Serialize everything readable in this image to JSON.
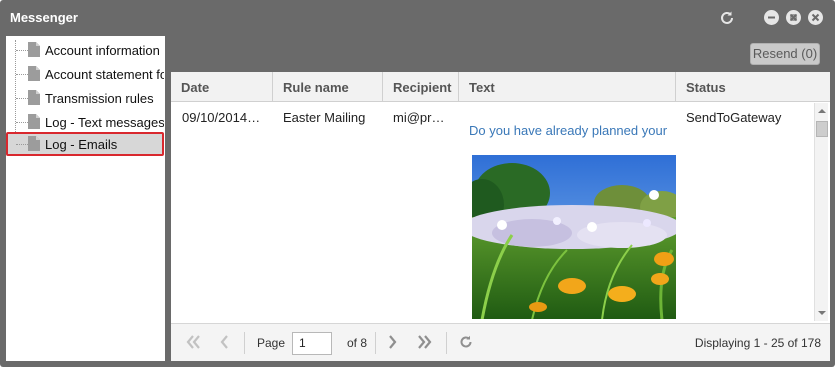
{
  "window": {
    "title": "Messenger"
  },
  "sidebar": {
    "items": [
      {
        "label": "Account information"
      },
      {
        "label": "Account statement for"
      },
      {
        "label": "Transmission rules"
      },
      {
        "label": "Log - Text messages"
      },
      {
        "label": "Log - Emails",
        "selected": true
      }
    ]
  },
  "toolbar": {
    "resend_label": "Resend (0)"
  },
  "grid": {
    "columns": [
      "Date",
      "Rule name",
      "Recipient",
      "Text",
      "Status"
    ],
    "rows": [
      {
        "date": "09/10/2014…",
        "rule_name": "Easter Mailing",
        "recipient": "mi@pr…",
        "text": "Do you have already planned your",
        "status": "SendToGateway"
      }
    ]
  },
  "pager": {
    "page_label": "Page",
    "page_value": "1",
    "of_label": "of 8",
    "display_text": "Displaying 1 - 25 of 178"
  },
  "colors": {
    "window_bg": "#6a6a6a",
    "selection_border": "#d9282e",
    "link_text": "#3a78b8"
  }
}
